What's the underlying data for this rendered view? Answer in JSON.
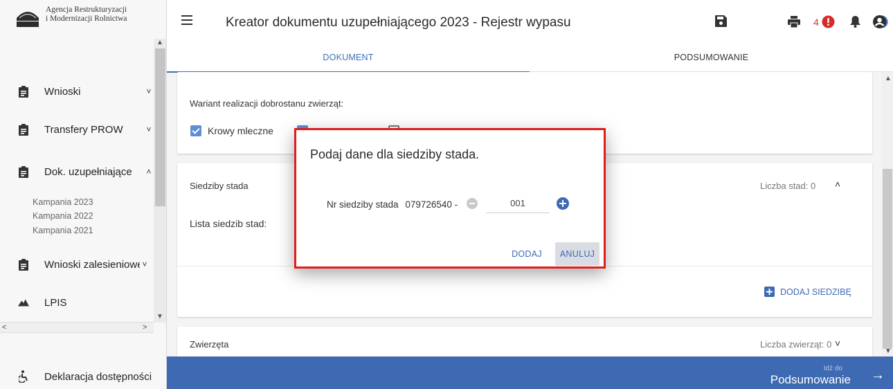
{
  "sidebar": {
    "logo_line1": "Agencja Restrukturyzacji",
    "logo_line2": "i Modernizacji Rolnictwa",
    "logo_abbr": "ARiMR",
    "items": [
      {
        "label": "Wnioski",
        "icon": "clipboard-icon",
        "chevron": "˅"
      },
      {
        "label": "Transfery PROW",
        "icon": "clipboard-icon",
        "chevron": "˅"
      },
      {
        "label": "Dok. uzupełniające",
        "icon": "clipboard-icon",
        "chevron": "˄"
      },
      {
        "label": "Wnioski zalesieniowe",
        "icon": "clipboard-icon",
        "chevron": "˅"
      },
      {
        "label": "LPIS",
        "icon": "mountain-icon",
        "chevron": ""
      }
    ],
    "sub_items": [
      "Kampania 2023",
      "Kampania 2022",
      "Kampania 2021"
    ],
    "bottom_item": {
      "label": "Deklaracja dostępności",
      "icon": "accessibility-icon"
    }
  },
  "header": {
    "title": "Kreator dokumentu uzupełniającego 2023 - Rejestr wypasu",
    "notification_count": "4",
    "icons": [
      "save-icon",
      "print-icon",
      "error-icon",
      "bell-icon",
      "help-icon",
      "account-icon"
    ],
    "colors": {
      "accent": "#3e69b3",
      "error": "#e03131"
    }
  },
  "tabs": [
    {
      "label": "DOKUMENT",
      "active": true
    },
    {
      "label": "PODSUMOWANIE",
      "active": false
    }
  ],
  "main": {
    "variant_label": "Wariant realizacji dobrostanu zwierząt:",
    "checkboxes": [
      {
        "label": "Krowy mleczne",
        "checked": true
      },
      {
        "label": "",
        "checked": true
      },
      {
        "label": "",
        "checked": false
      }
    ],
    "herd_section": {
      "title": "Siedziby stada",
      "count_label": "Liczba stad: 0",
      "list_label": "Lista siedzib stad:",
      "add_button": "DODAJ SIEDZIBĘ"
    },
    "animals_section": {
      "title": "Zwierzęta",
      "count_label": "Liczba zwierząt: 0"
    }
  },
  "footer": {
    "small": "Idź do",
    "big": "Podsumowanie"
  },
  "dialog": {
    "title": "Podaj dane dla siedziby stada.",
    "field_label": "Nr siedziby stada",
    "prefix": "079726540 -",
    "value": "001",
    "confirm": "DODAJ",
    "cancel": "ANULUJ"
  }
}
